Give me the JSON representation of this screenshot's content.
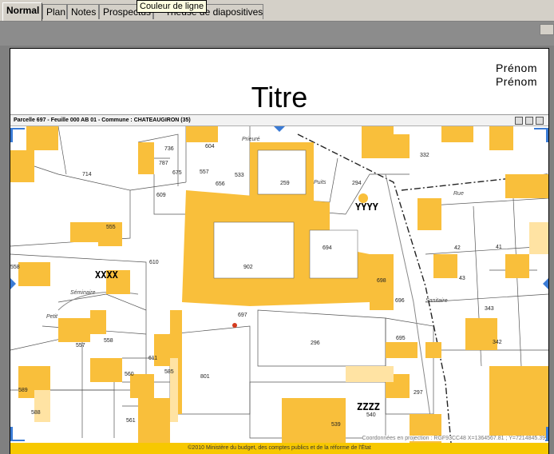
{
  "tabs": [
    {
      "label": "Normal",
      "active": true
    },
    {
      "label": "Plan"
    },
    {
      "label": "Notes"
    },
    {
      "label": "Prospectus"
    },
    {
      "label": "Trieuse de diapositives"
    }
  ],
  "tooltip": "Couleur de ligne",
  "slide": {
    "title": "Titre",
    "names": [
      "Prénom",
      "Prénom"
    ]
  },
  "map": {
    "header": "Parcelle 697 - Feuille 000 AB 01 - Commune : CHATEAUGIRON (35)",
    "coords": "Coordonnées en projection : RGF93CC48    X=1364567.81 ; Y=7214845.39",
    "footer": "©2010 Ministère du budget, des comptes publics et de la réforme de l'État",
    "tags": {
      "xxxx": "XXXX",
      "yyyy": "YYYY",
      "zzzz": "ZZZZ"
    },
    "streets": [
      "Prieuré",
      "Séminaire",
      "Petit",
      "Puits",
      "Rue",
      "Sanitaire"
    ],
    "parcels": [
      "736",
      "604",
      "787",
      "675",
      "557",
      "656",
      "533",
      "714",
      "609",
      "259",
      "294",
      "332",
      "555",
      "610",
      "902",
      "694",
      "698",
      "696",
      "558",
      "557",
      "558",
      "611",
      "585",
      "801",
      "296",
      "695",
      "560",
      "589",
      "588",
      "561",
      "297",
      "539",
      "540",
      "42",
      "41",
      "43",
      "343",
      "342",
      "697"
    ],
    "colors": {
      "building": "#f9bf3b",
      "building_light": "#ffe3a3",
      "line": "#555555"
    }
  }
}
